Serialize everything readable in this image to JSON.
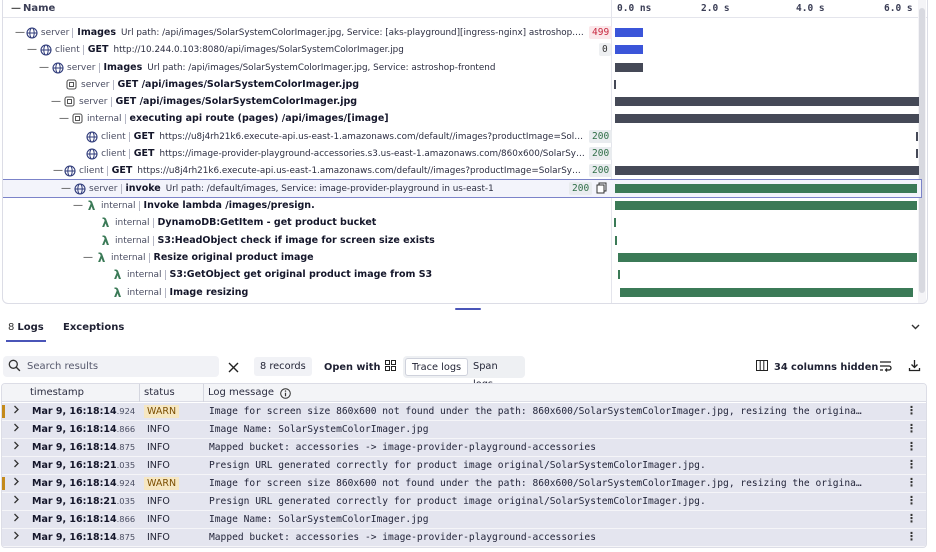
{
  "trace": {
    "header": {
      "name": "Name",
      "ticks": [
        "0.0 ns",
        "2.0 s",
        "4.0 s",
        "6.0 s"
      ]
    },
    "rows": [
      {
        "kind": "server",
        "title": "Images",
        "detail": "Url path: /api/images/SolarSystemColorImager.jpg, Service: [aks-playground][ingress-nginx] astroshop.playground...",
        "status": "499"
      },
      {
        "kind": "client",
        "title": "GET",
        "detail": "http://10.244.0.103:8080/api/images/SolarSystemColorImager.jpg",
        "status": "0"
      },
      {
        "kind": "server",
        "title": "Images",
        "detail": "Url path: /api/images/SolarSystemColorImager.jpg, Service: astroshop-frontend",
        "status": ""
      },
      {
        "kind": "server",
        "title": "GET /api/images/SolarSystemColorImager.jpg",
        "detail": "",
        "status": ""
      },
      {
        "kind": "server",
        "title": "GET /api/images/SolarSystemColorImager.jpg",
        "detail": "",
        "status": ""
      },
      {
        "kind": "internal",
        "title": "executing api route (pages) /api/images/[image]",
        "detail": "",
        "status": ""
      },
      {
        "kind": "client",
        "title": "GET",
        "detail": "https://u8j4rh21k6.execute-api.us-east-1.amazonaws.com/default//images?productImage=SolarSystem...",
        "status": "200"
      },
      {
        "kind": "client",
        "title": "GET",
        "detail": "https://image-provider-playground-accessories.s3.us-east-1.amazonaws.com/860x600/SolarSystemCol...",
        "status": "200"
      },
      {
        "kind": "client",
        "title": "GET",
        "detail": "https://u8j4rh21k6.execute-api.us-east-1.amazonaws.com/default//images?productImage=SolarSystemColorI...",
        "status": "200"
      },
      {
        "kind": "server",
        "title": "invoke",
        "detail": "Url path: /default/images, Service: image-provider-playground in us-east-1",
        "status": "200"
      },
      {
        "kind": "internal",
        "title": "Invoke lambda /images/presign.",
        "detail": "",
        "status": ""
      },
      {
        "kind": "internal",
        "title": "DynamoDB:GetItem - get product bucket",
        "detail": "",
        "status": ""
      },
      {
        "kind": "internal",
        "title": "S3:HeadObject check if image for screen size exists",
        "detail": "",
        "status": ""
      },
      {
        "kind": "internal",
        "title": "Resize original product image",
        "detail": "",
        "status": ""
      },
      {
        "kind": "internal",
        "title": "S3:GetObject get original product image from S3",
        "detail": "",
        "status": ""
      },
      {
        "kind": "internal",
        "title": "Image resizing",
        "detail": "",
        "status": ""
      }
    ]
  },
  "tabs": {
    "logs_count": "8",
    "logs_label": "Logs",
    "exceptions_label": "Exceptions"
  },
  "toolbar": {
    "search_placeholder": "Search results",
    "records": "8 records",
    "open_with": "Open with",
    "trace_logs": "Trace logs",
    "span_logs": "Span logs",
    "columns_hidden": "34 columns hidden"
  },
  "table": {
    "headers": {
      "timestamp": "timestamp",
      "status": "status",
      "message": "Log message"
    },
    "rows": [
      {
        "ts": "Mar 9, 16:18:14",
        "ms": ".924",
        "status": "WARN",
        "msg": "Image for screen size 860x600 not found under the path: 860x600/SolarSystemColorImager.jpg, resizing the origina…"
      },
      {
        "ts": "Mar 9, 16:18:14",
        "ms": ".866",
        "status": "INFO",
        "msg": "Image Name: SolarSystemColorImager.jpg"
      },
      {
        "ts": "Mar 9, 16:18:14",
        "ms": ".875",
        "status": "INFO",
        "msg": "Mapped bucket: accessories -> image-provider-playground-accessories"
      },
      {
        "ts": "Mar 9, 16:18:21",
        "ms": ".035",
        "status": "INFO",
        "msg": "Presign URL generated correctly for product image original/SolarSystemColorImager.jpg."
      },
      {
        "ts": "Mar 9, 16:18:14",
        "ms": ".924",
        "status": "WARN",
        "msg": "Image for screen size 860x600 not found under the path: 860x600/SolarSystemColorImager.jpg, resizing the origina…"
      },
      {
        "ts": "Mar 9, 16:18:21",
        "ms": ".035",
        "status": "INFO",
        "msg": "Presign URL generated correctly for product image original/SolarSystemColorImager.jpg."
      },
      {
        "ts": "Mar 9, 16:18:14",
        "ms": ".866",
        "status": "INFO",
        "msg": "Image Name: SolarSystemColorImager.jpg"
      },
      {
        "ts": "Mar 9, 16:18:14",
        "ms": ".875",
        "status": "INFO",
        "msg": "Mapped bucket: accessories -> image-provider-playground-accessories"
      }
    ]
  },
  "colors": {
    "accent": "#4a55b8",
    "bar_blue": "#3b55d9",
    "bar_dark": "#454957",
    "bar_green": "#3b7a57",
    "warn": "#c48a1b"
  }
}
